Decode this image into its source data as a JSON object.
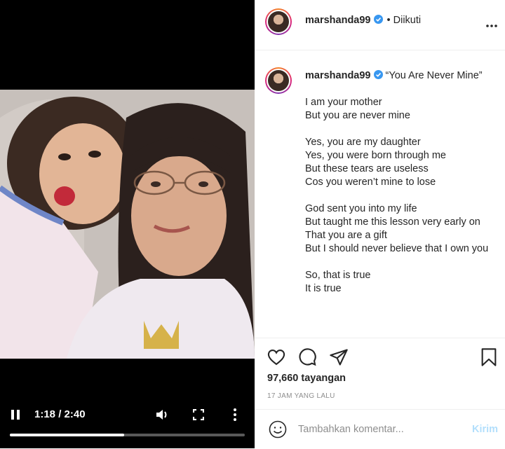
{
  "video": {
    "current_time": "1:18",
    "duration": "2:40",
    "time_display": "1:18 / 2:40",
    "progress_fraction": 0.4875,
    "icons": [
      "pause-icon",
      "volume-icon",
      "fullscreen-icon",
      "more-vert-icon"
    ]
  },
  "header": {
    "username": "marshanda99",
    "verified": true,
    "follow_status": "• Diikuti",
    "icons": [
      "verified-icon",
      "more-horizontal-icon"
    ]
  },
  "caption": {
    "username": "marshanda99",
    "title": "“You Are Never Mine”",
    "stanzas": [
      [
        "I am your mother",
        "But you are never mine"
      ],
      [
        "Yes, you are my daughter",
        "Yes, you were born through me",
        "But these tears are useless",
        "Cos you weren’t mine to lose"
      ],
      [
        "God sent you into my life",
        "But taught me this lesson very early on",
        "That you are a gift",
        "But I should never believe that I own you"
      ],
      [
        "So, that is true",
        "It is true"
      ]
    ]
  },
  "actions": {
    "icons": [
      "heart-icon",
      "comment-icon",
      "share-icon",
      "bookmark-icon"
    ],
    "views": "97,660 tayangan",
    "time_ago": "17 JAM YANG LALU"
  },
  "comment": {
    "placeholder": "Tambahkan komentar...",
    "value": "",
    "send_label": "Kirim",
    "icon": "smile-icon"
  },
  "colors": {
    "verified_blue": "#3897f0",
    "send_disabled": "#b2dffc",
    "muted_text": "#8e8e8e",
    "video_bg": "#000000"
  }
}
